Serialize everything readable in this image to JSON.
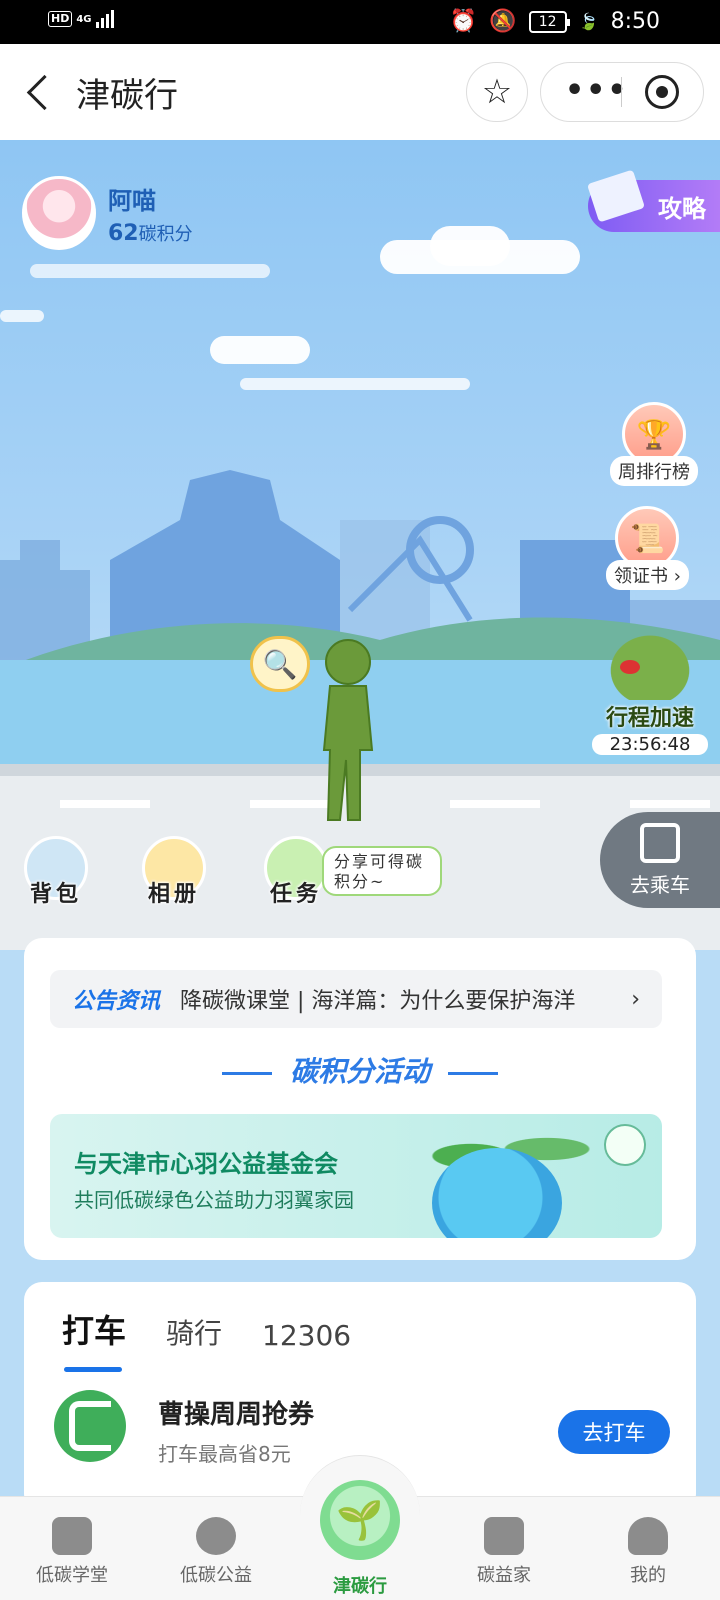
{
  "status_bar": {
    "hd": "HD",
    "network": "4G",
    "battery": "12",
    "time": "8:50"
  },
  "nav": {
    "title": "津碳行",
    "more": "•••"
  },
  "profile": {
    "name": "阿喵",
    "points": "62",
    "points_unit": "碳积分"
  },
  "guide_label": "攻略",
  "side_buttons": {
    "weekly_rank": "周排行榜",
    "certificate": "领证书 ›"
  },
  "trip_accelerate": {
    "label": "行程加速",
    "countdown": "23:56:48"
  },
  "scene_buttons": {
    "backpack": "背包",
    "album": "相册",
    "tasks": "任务",
    "share_tip": "分享可得碳积分~",
    "take_bus": "去乘车"
  },
  "notice": {
    "tag": "公告资讯",
    "text": "降碳微课堂 | 海洋篇：为什么要保护海洋"
  },
  "activity": {
    "title": "碳积分活动",
    "banner_title": "与天津市心羽公益基金会",
    "banner_subtitle": "共同低碳绿色公益助力羽翼家园"
  },
  "travel": {
    "tabs": [
      "打车",
      "骑行",
      "12306"
    ],
    "active_tab": 0,
    "offer_title": "曹操周周抢券",
    "offer_subtitle": "打车最高省8元",
    "offer_button": "去打车"
  },
  "bottom_nav": [
    {
      "label": "低碳学堂",
      "icon": "book-icon"
    },
    {
      "label": "低碳公益",
      "icon": "heart-hand-icon"
    },
    {
      "label": "津碳行",
      "icon": "leaf-icon"
    },
    {
      "label": "碳益家",
      "icon": "store-icon"
    },
    {
      "label": "我的",
      "icon": "user-icon"
    }
  ],
  "colors": {
    "primary": "#1a73e8",
    "green": "#2b9b40",
    "sky": "#a9d3f6"
  }
}
